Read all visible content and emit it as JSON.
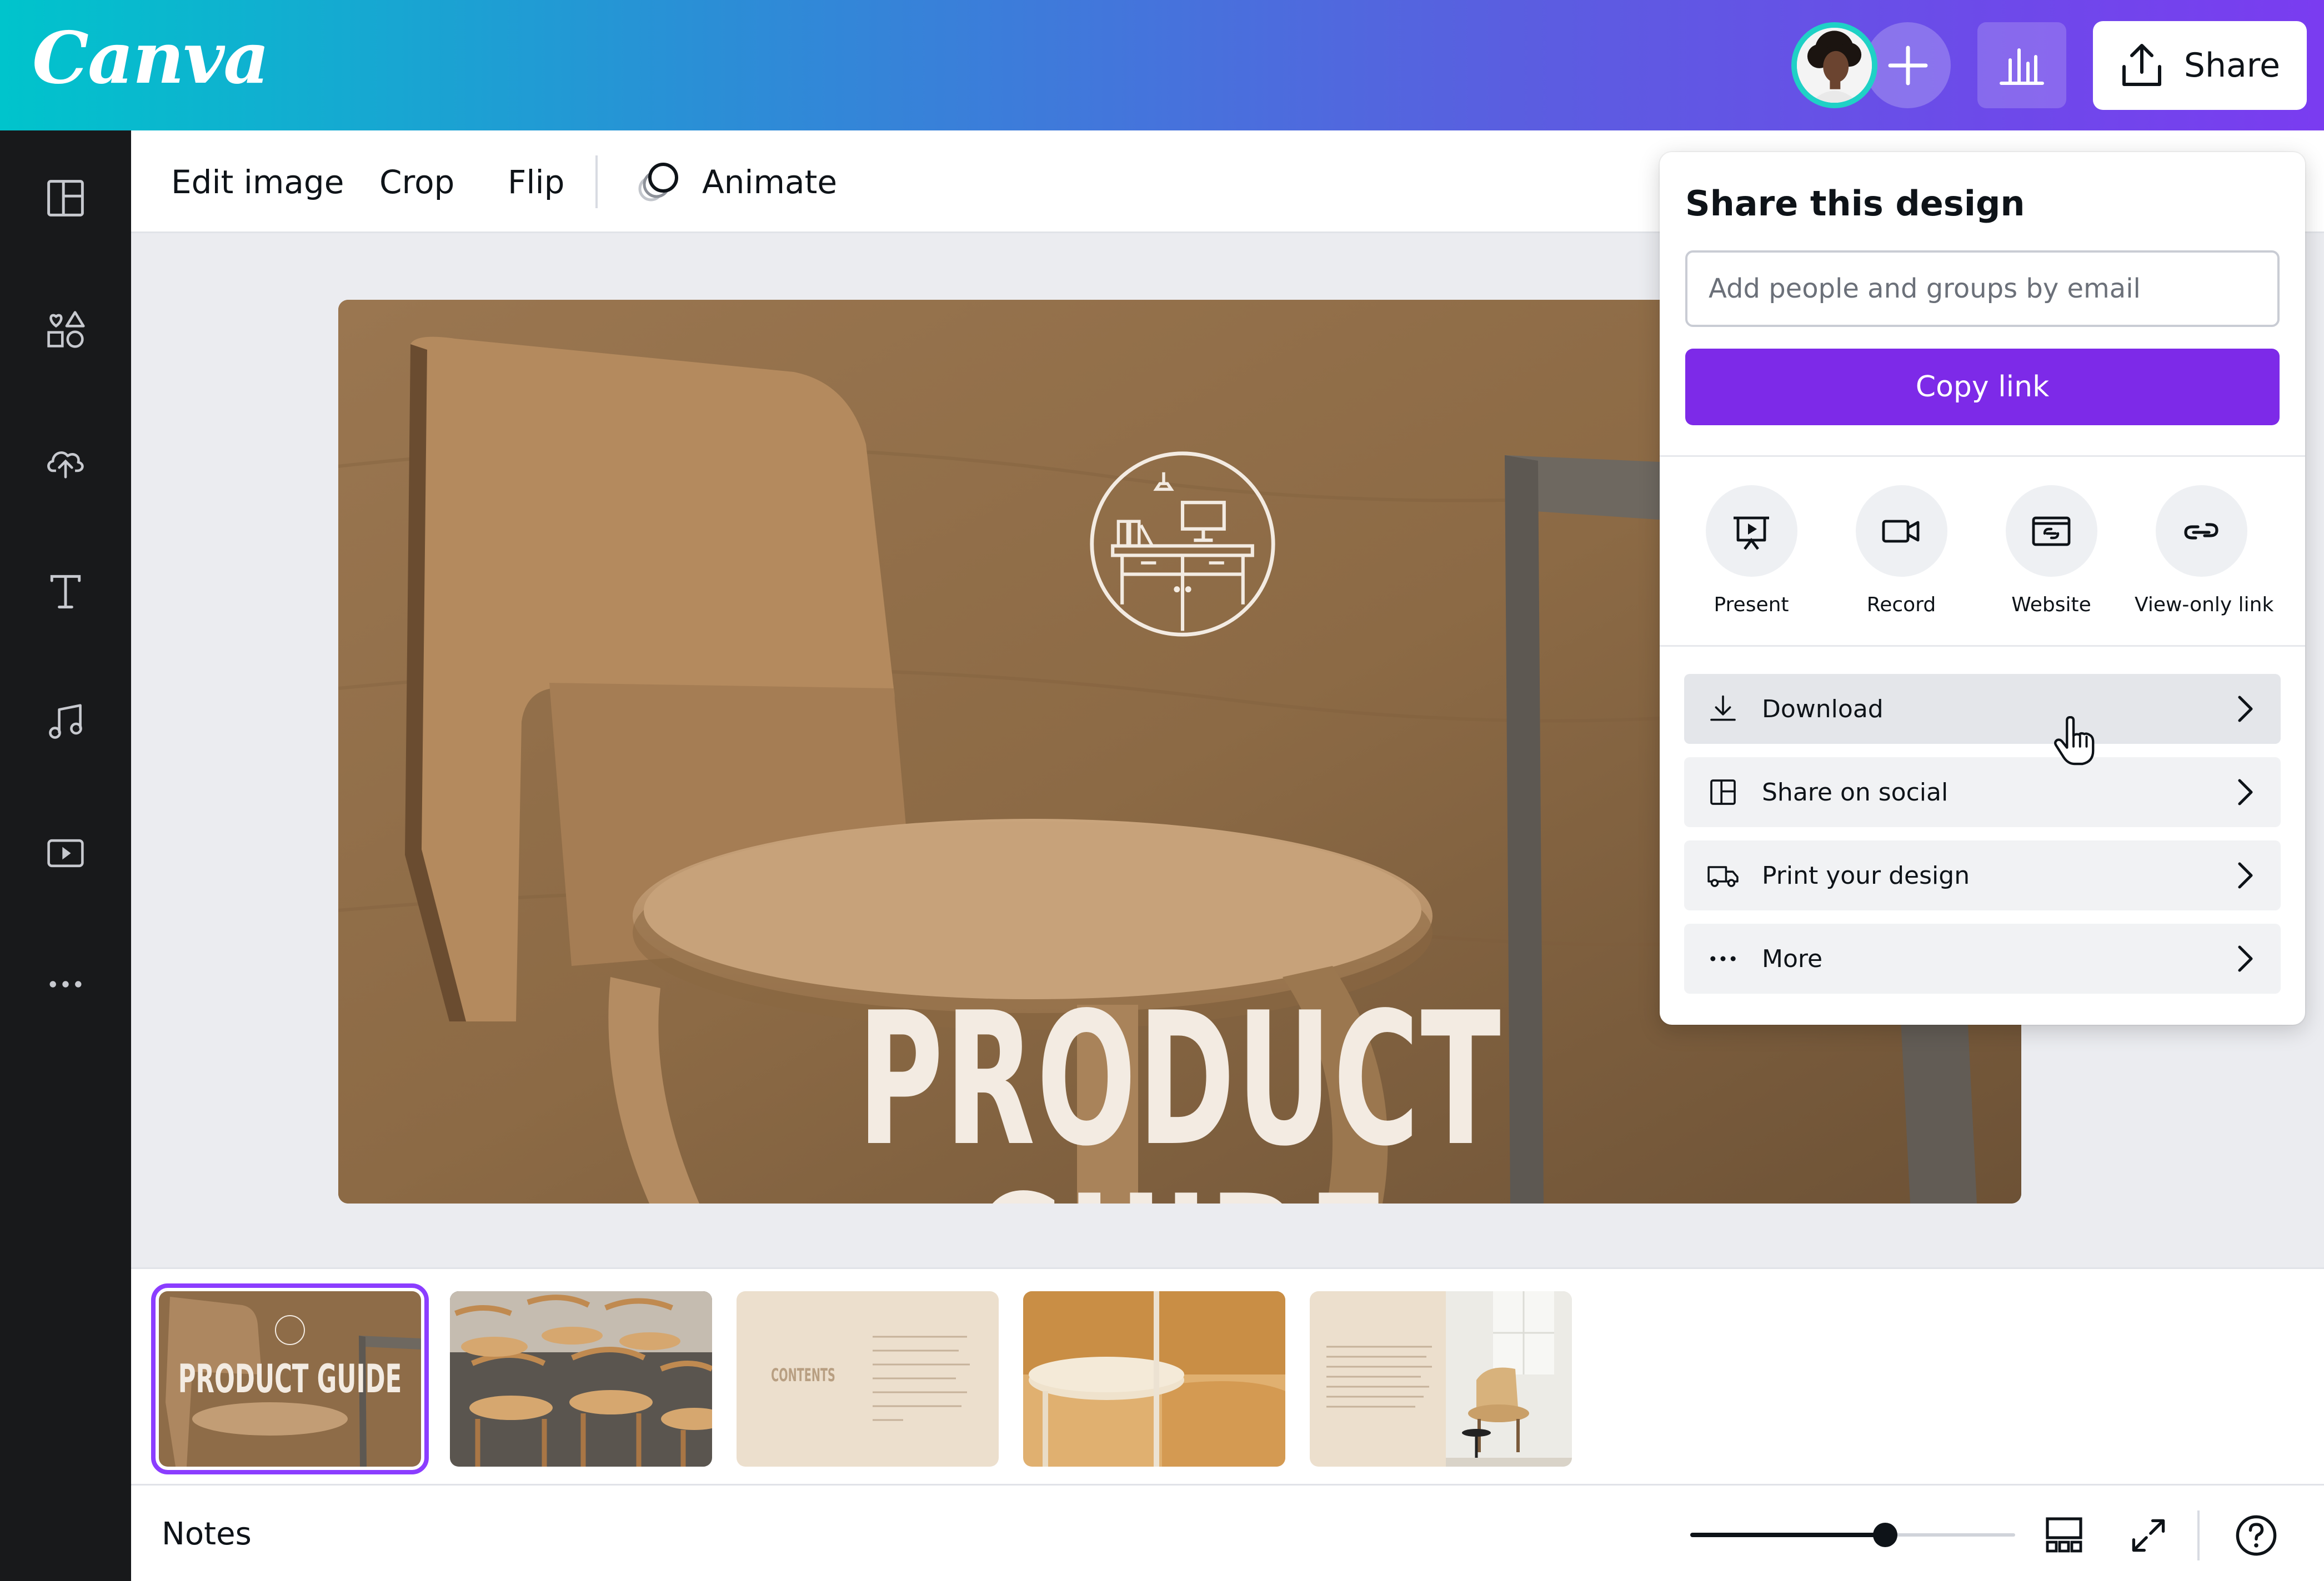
{
  "app": {
    "logo": "Canva"
  },
  "header": {
    "share_label": "Share"
  },
  "toolbar": {
    "edit_image": "Edit image",
    "crop": "Crop",
    "flip": "Flip",
    "animate": "Animate"
  },
  "slide": {
    "title": "PRODUCT GUIDE"
  },
  "share_panel": {
    "title": "Share this design",
    "email_placeholder": "Add people and groups by email",
    "copy_link": "Copy link",
    "options": [
      {
        "label": "Present",
        "icon": "present-icon"
      },
      {
        "label": "Record",
        "icon": "record-icon"
      },
      {
        "label": "Website",
        "icon": "website-icon"
      },
      {
        "label": "View-only link",
        "icon": "link-icon"
      }
    ],
    "rows": [
      {
        "label": "Download",
        "icon": "download-icon"
      },
      {
        "label": "Share on social",
        "icon": "social-icon"
      },
      {
        "label": "Print your design",
        "icon": "truck-icon"
      },
      {
        "label": "More",
        "icon": "more-icon"
      }
    ]
  },
  "filmstrip": {
    "slide1_title": "PRODUCT GUIDE",
    "slide3_title": "CONTENTS"
  },
  "bottom": {
    "notes": "Notes",
    "zoom_fraction": 0.6
  },
  "colors": {
    "accent": "#7d2ae8",
    "selected_outline": "#8b3dff",
    "sidebar": "#18191b"
  }
}
